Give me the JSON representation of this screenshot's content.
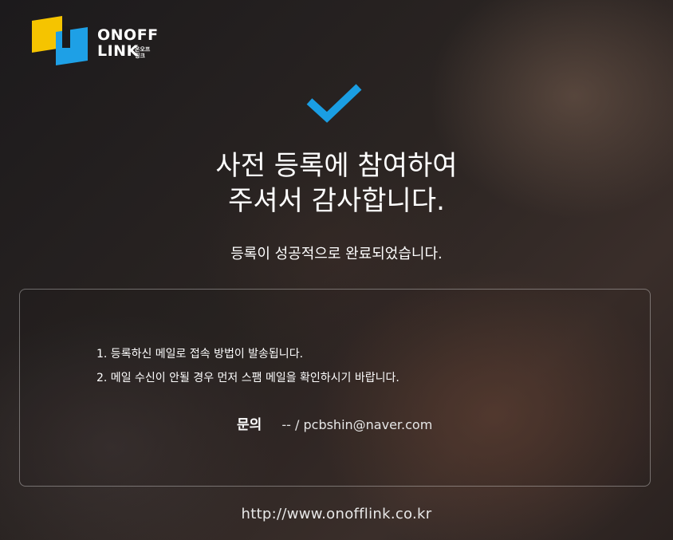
{
  "logo": {
    "main_line1": "ONOFF",
    "main_line2": "LINK",
    "sub_line1": "온오프",
    "sub_line2": "링크",
    "colors": {
      "yellow": "#f5c400",
      "blue": "#1ea0e6"
    }
  },
  "success_icon": "checkmark-icon",
  "accent_color": "#1a9ee3",
  "headline": {
    "line1": "사전 등록에 참여하여",
    "line2": "주셔서 감사합니다."
  },
  "subheadline": "등록이 성공적으로 완료되었습니다.",
  "notices": [
    "1. 등록하신 메일로 접속 방법이 발송됩니다.",
    "2. 메일 수신이 안될 경우 먼저 스팸 메일을 확인하시기 바랍니다."
  ],
  "contact": {
    "label": "문의",
    "value": "-- / pcbshin@naver.com"
  },
  "site_url": "http://www.onofflink.co.kr"
}
